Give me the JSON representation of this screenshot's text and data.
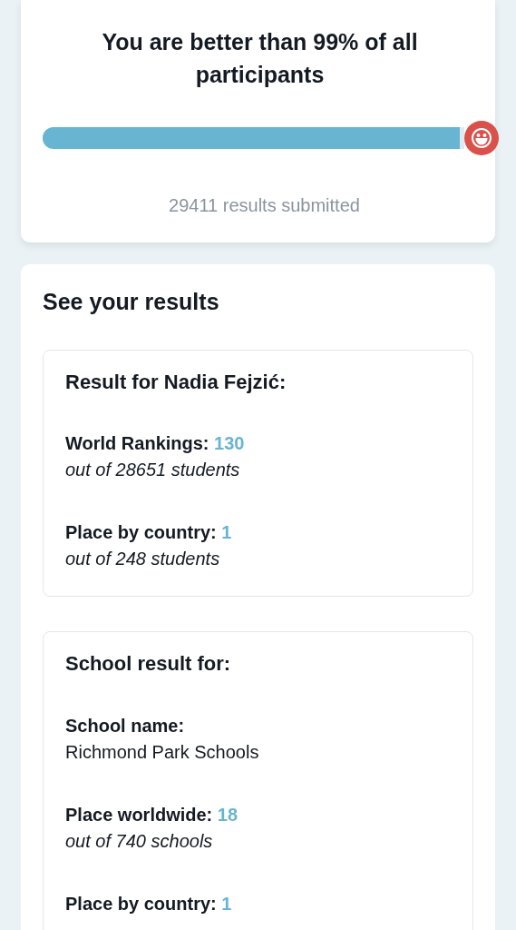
{
  "summary": {
    "heading": "You are better than 99% of all participants",
    "level": 0.99,
    "submitted": "29411 results submitted"
  },
  "results": {
    "title": "See your results",
    "boxes": [
      {
        "title": "Result for Nadia Fejzić:",
        "fields": [
          {
            "kind": "rank",
            "label": "World Rankings:",
            "value": "130",
            "detail": "out of 28651 students"
          },
          {
            "kind": "rank",
            "label": "Place by country:",
            "value": "1",
            "detail": "out of 248 students"
          }
        ]
      },
      {
        "title": "School result for:",
        "fields": [
          {
            "kind": "text",
            "label": "School name:",
            "detail": "Richmond Park Schools"
          },
          {
            "kind": "rank",
            "label": "Place worldwide:",
            "value": "18",
            "detail": "out of 740 schools"
          },
          {
            "kind": "rank",
            "label": "Place by country:",
            "value": "1"
          }
        ]
      }
    ]
  }
}
